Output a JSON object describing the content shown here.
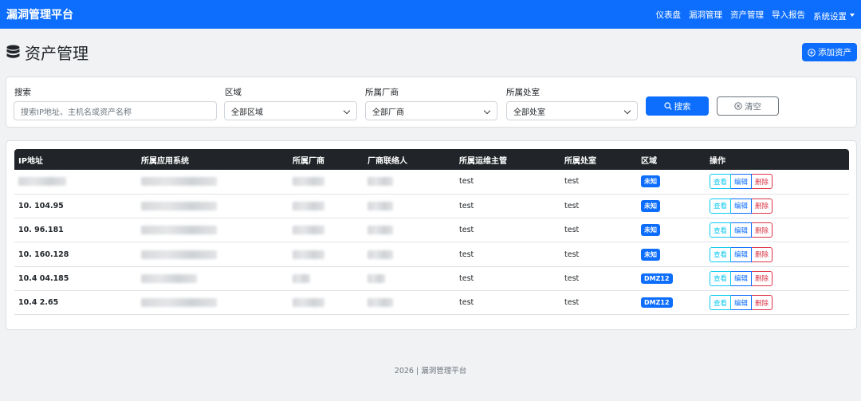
{
  "navbar": {
    "brand": "漏洞管理平台",
    "links": [
      "仪表盘",
      "漏洞管理",
      "资产管理",
      "导入报告",
      "系统设置"
    ]
  },
  "page": {
    "title": "资产管理",
    "add_button": "添加资产"
  },
  "filters": {
    "search_label": "搜索",
    "search_placeholder": "搜索IP地址、主机名或资产名称",
    "region_label": "区域",
    "region_value": "全部区域",
    "vendor_label": "所属厂商",
    "vendor_value": "全部厂商",
    "office_label": "所属处室",
    "office_value": "全部处室",
    "search_button": "搜索",
    "clear_button": "清空"
  },
  "table": {
    "columns": [
      "IP地址",
      "所属应用系统",
      "所属厂商",
      "厂商联络人",
      "所属运维主管",
      "所属处室",
      "区域",
      "操作"
    ],
    "rows": [
      {
        "ip": "",
        "manager": "test",
        "office": "test",
        "region": "未知"
      },
      {
        "ip": "10.   104.95",
        "manager": "test",
        "office": "test",
        "region": "未知"
      },
      {
        "ip": "10.   96.181",
        "manager": "test",
        "office": "test",
        "region": "未知"
      },
      {
        "ip": "10.   160.128",
        "manager": "test",
        "office": "test",
        "region": "未知"
      },
      {
        "ip": "10.4  04.185",
        "manager": "test",
        "office": "test",
        "region": "DMZ12"
      },
      {
        "ip": "10.4  2.65",
        "manager": "test",
        "office": "test",
        "region": "DMZ12"
      }
    ],
    "actions": {
      "view": "查看",
      "edit": "编辑",
      "delete": "删除"
    }
  },
  "footer": "2026 | 漏洞管理平台",
  "colors": {
    "primary": "#0d6efd",
    "dark": "#212529",
    "info": "#0dcaf0",
    "danger": "#dc3545"
  }
}
